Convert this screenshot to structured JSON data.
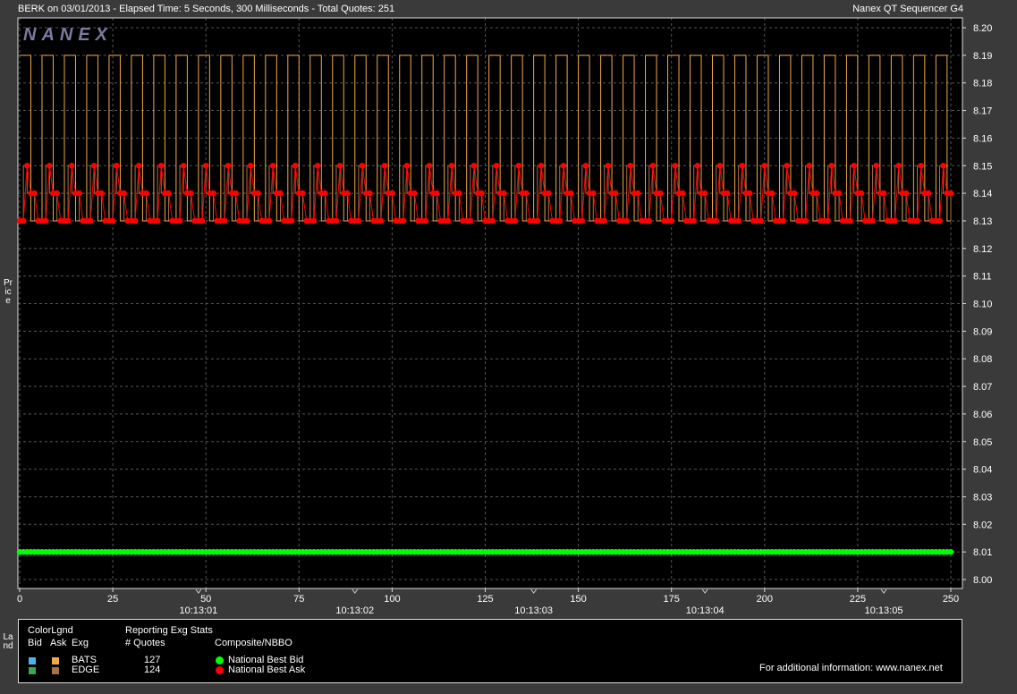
{
  "header": {
    "left": "BERK on 03/01/2013  -  Elapsed Time: 5 Seconds, 300 Milliseconds  -  Total Quotes: 251",
    "right": "Nanex QT Sequencer G4"
  },
  "watermark": "NANEX",
  "y_axis_label": "Price",
  "legend_label": "Land",
  "legend": {
    "color_legend_title": "ColorLgnd",
    "col_bid": "Bid",
    "col_ask": "Ask",
    "col_exg": "Exg",
    "stats_title": "Reporting Exg Stats",
    "stats_col": "# Quotes",
    "composite_title": "Composite/NBBO",
    "exchanges": [
      {
        "name": "BATS",
        "quotes": "127",
        "bid_color": "#4fb3ea",
        "ask_color": "#f0a848"
      },
      {
        "name": "EDGE",
        "quotes": "124",
        "bid_color": "#3aa84a",
        "ask_color": "#a8704a"
      }
    ],
    "nbbo": [
      {
        "label": "National Best Bid",
        "color": "#00ff00"
      },
      {
        "label": "National Best Ask",
        "color": "#ff0000"
      }
    ],
    "info": "For additional information: www.nanex.net"
  },
  "chart_data": {
    "type": "line",
    "title": "BERK on 03/01/2013",
    "xlabel": "",
    "ylabel": "Price",
    "xlim": [
      0,
      251
    ],
    "ylim": [
      8.0,
      8.2
    ],
    "x_ticks": [
      0,
      25,
      50,
      75,
      100,
      125,
      150,
      175,
      200,
      225,
      250
    ],
    "y_ticks": [
      "8.20",
      "8.19",
      "8.18",
      "8.17",
      "8.16",
      "8.15",
      "8.14",
      "8.13",
      "8.12",
      "8.11",
      "8.10",
      "8.09",
      "8.08",
      "8.07",
      "8.06",
      "8.05",
      "8.04",
      "8.03",
      "8.02",
      "8.01",
      "8.00"
    ],
    "time_ticks": [
      {
        "x": 48,
        "label": "10:13:01"
      },
      {
        "x": 90,
        "label": "10:13:02"
      },
      {
        "x": 138,
        "label": "10:13:03"
      },
      {
        "x": 184,
        "label": "10:13:04"
      },
      {
        "x": 232,
        "label": "10:13:05"
      }
    ],
    "grid": true,
    "series": [
      {
        "name": "National Best Bid",
        "color": "#00ff00",
        "constant": 8.01,
        "count": 251
      },
      {
        "name": "National Best Ask",
        "color": "#ff0000",
        "pattern": [
          8.13,
          8.13,
          8.15,
          8.14,
          8.14,
          8.13
        ],
        "count": 251
      },
      {
        "name": "BATS",
        "color": "#f0a848",
        "pattern": [
          8.19,
          8.19,
          8.19,
          8.13,
          8.13,
          8.13
        ],
        "count": 251
      },
      {
        "name": "EDGE",
        "color": "#a8704a",
        "pattern": [
          8.13,
          8.15,
          8.14,
          8.14,
          8.13,
          8.13
        ],
        "count": 251
      }
    ]
  }
}
